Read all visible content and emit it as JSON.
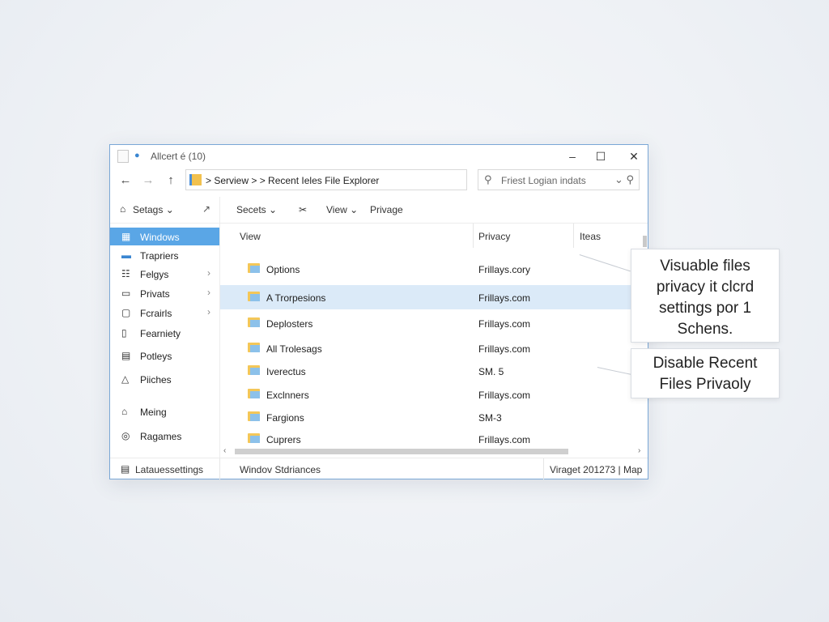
{
  "window": {
    "title": "Allcert é (10)",
    "controls": {
      "minimize": "–",
      "maximize": "☐",
      "close": "✕"
    }
  },
  "nav": {
    "back": "←",
    "forward": "→",
    "up": "↑",
    "breadcrumb": "> Serview >  > Recent Ieles  File Explorer",
    "search_placeholder": "Friest Logian indats",
    "search_dropdown": "⌄",
    "icons": {
      "address": "folder-icon",
      "search": "search-icon"
    }
  },
  "sidebar": {
    "header": {
      "label": "Setags ⌄",
      "pin": "↗"
    },
    "items": [
      {
        "label": "Windows",
        "icon": "▦",
        "chevron": "",
        "active": true
      },
      {
        "label": "Trapriers",
        "icon": "▬",
        "chevron": ""
      },
      {
        "label": "Felgys",
        "icon": "☷",
        "chevron": "›"
      },
      {
        "label": "Privats",
        "icon": "▭",
        "chevron": "›"
      },
      {
        "label": "Fcrairls",
        "icon": "▢",
        "chevron": "›"
      },
      {
        "label": "Fearniety",
        "icon": "▯",
        "chevron": ""
      },
      {
        "label": "Potleys",
        "icon": "▤",
        "chevron": ""
      },
      {
        "label": "Piiches",
        "icon": "△",
        "chevron": ""
      },
      {
        "label": "Meing",
        "icon": "⌂",
        "chevron": ""
      },
      {
        "label": "Ragames",
        "icon": "◎",
        "chevron": ""
      }
    ]
  },
  "toolbar": {
    "secets": "Secets ⌄",
    "cut": "✂",
    "view": "View ⌄",
    "privage": "Privage"
  },
  "columns": {
    "view": "View",
    "privacy": "Privacy",
    "items": "Iteas"
  },
  "files": [
    {
      "name": "Options",
      "privacy": "Frillays.cory"
    },
    {
      "name": "A Trorpesions",
      "privacy": "Frillays.com",
      "selected": true
    },
    {
      "name": "Deplosters",
      "privacy": "Frillays.com"
    },
    {
      "name": "All Trolesags",
      "privacy": "Frillays.com"
    },
    {
      "name": "Iverectus",
      "privacy": "SM. 5"
    },
    {
      "name": "Exclnners",
      "privacy": "Frillays.com"
    },
    {
      "name": "Fargions",
      "privacy": "SM-3"
    },
    {
      "name": "Cuprers",
      "privacy": "Frillays.com"
    }
  ],
  "scroll": {
    "left": "‹",
    "right": "›"
  },
  "status": {
    "left": "Latauessettings",
    "middle": "Windov Stdriances",
    "right": "Viraget 201273  | Map"
  },
  "callouts": {
    "first": [
      "Visuable files",
      "privacy it clcrd",
      "settings por 1",
      "Schens."
    ],
    "second": [
      "Disable Recent",
      "Files Privaoly"
    ]
  }
}
